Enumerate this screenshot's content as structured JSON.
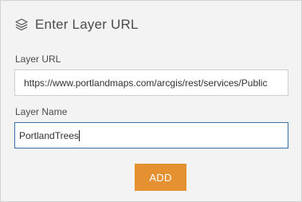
{
  "panel": {
    "title": "Enter Layer URL",
    "icon": "layers-icon"
  },
  "url_field": {
    "label": "Layer URL",
    "value": "https://www.portlandmaps.com/arcgis/rest/services/Public"
  },
  "name_field": {
    "label": "Layer Name",
    "value": "PortlandTrees"
  },
  "actions": {
    "add_label": "ADD"
  },
  "colors": {
    "accent": "#e69131",
    "focus_border": "#3b6fa6",
    "panel_bg": "#f3f3f3"
  }
}
